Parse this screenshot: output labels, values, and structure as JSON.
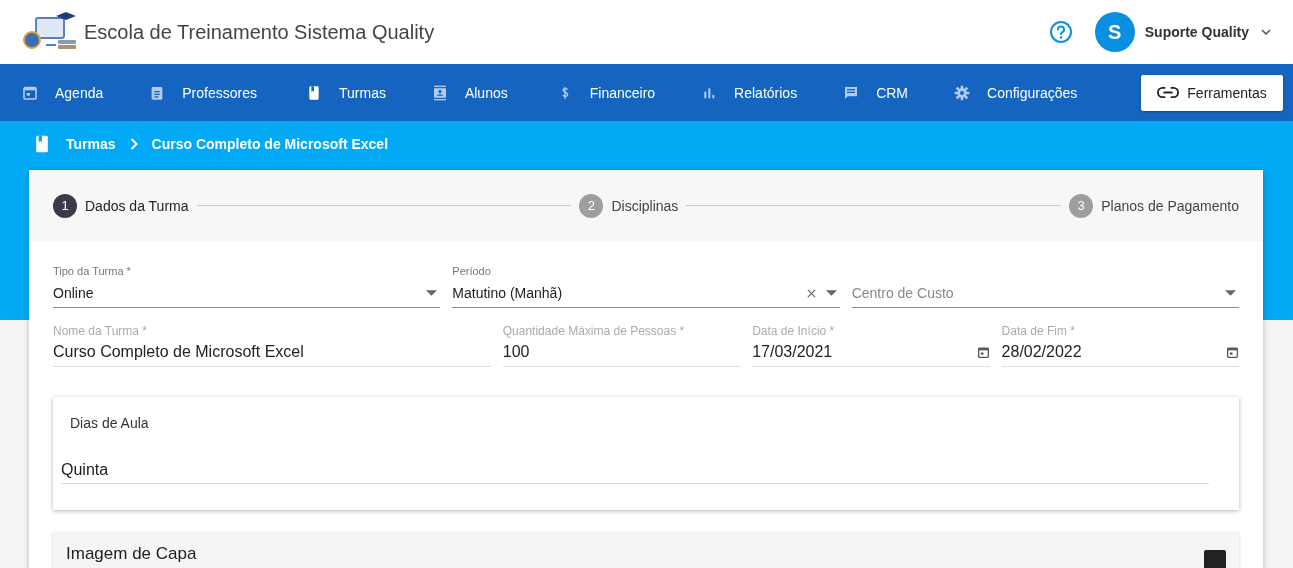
{
  "header": {
    "title": "Escola de Treinamento Sistema Quality",
    "user": {
      "initial": "S",
      "name": "Suporte Quality"
    }
  },
  "nav": {
    "items": [
      {
        "label": "Agenda"
      },
      {
        "label": "Professores"
      },
      {
        "label": "Turmas"
      },
      {
        "label": "Alunos"
      },
      {
        "label": "Financeiro"
      },
      {
        "label": "Relatórios"
      },
      {
        "label": "CRM"
      },
      {
        "label": "Configurações"
      }
    ],
    "tools_button": "Ferramentas"
  },
  "breadcrumb": [
    "Turmas",
    "Curso Completo de Microsoft Excel"
  ],
  "steps": [
    {
      "number": "1",
      "label": "Dados da Turma",
      "selected": true
    },
    {
      "number": "2",
      "label": "Disciplinas",
      "selected": false
    },
    {
      "number": "3",
      "label": "Planos de Pagamento",
      "selected": false
    }
  ],
  "form": {
    "row_1": [
      {
        "kind": "select",
        "label": "Tipo da Turma *",
        "value": "Online",
        "clearable": false
      },
      {
        "kind": "select",
        "label": "Período",
        "value": "Matutino (Manhã)",
        "clearable": true
      },
      {
        "kind": "select",
        "placeholder": "Centro de Custo",
        "clearable": false
      }
    ],
    "row_2": [
      {
        "kind": "text",
        "label": "Nome da Turma *",
        "value": "Curso Completo de Microsoft Excel"
      },
      {
        "kind": "text",
        "label": "Quantidade Máxima de Pessoas *",
        "value": "100"
      },
      {
        "kind": "date",
        "label": "Data de Início  *",
        "value": "17/03/2021"
      },
      {
        "kind": "date",
        "label": "Data de Fim  *",
        "value": "28/02/2022"
      }
    ]
  },
  "class_days": {
    "title": "Dias de Aula",
    "value": "Quinta"
  },
  "cover_image": {
    "title": "Imagem de Capa"
  }
}
